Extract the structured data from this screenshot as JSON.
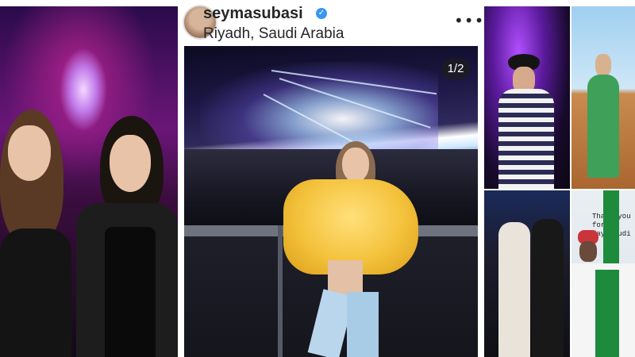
{
  "post": {
    "username": "seymasubasi",
    "location": "Riyadh, Saudi Arabia",
    "page_indicator": "1/2",
    "more_icon": "more-options-icon",
    "verified_icon": "verified-badge-icon"
  },
  "collage": {
    "story_text": "Thank you for\nday Saudi"
  },
  "colors": {
    "verified": "#3897f0",
    "username": "#262626"
  }
}
